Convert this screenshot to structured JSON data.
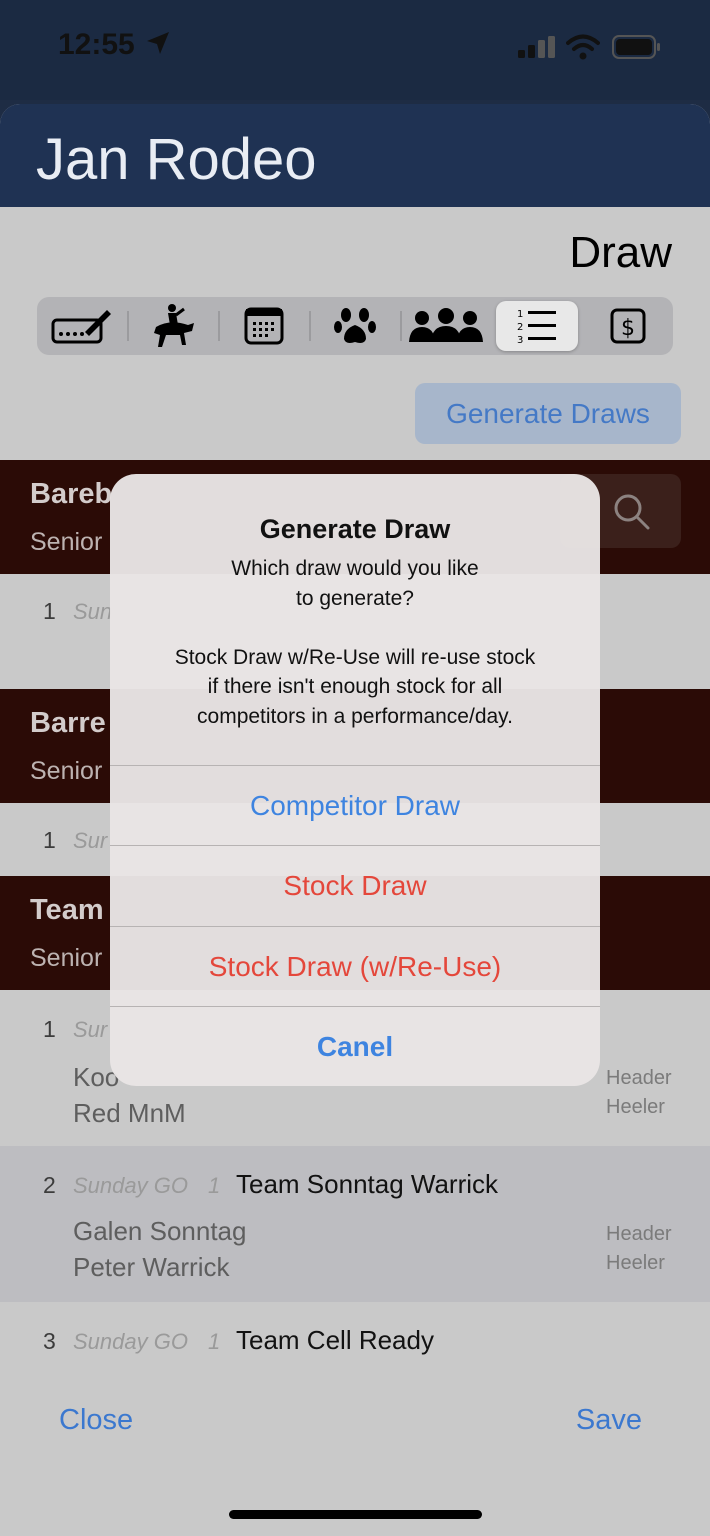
{
  "status_bar": {
    "time": "12:55"
  },
  "header": {
    "title": "Jan Rodeo"
  },
  "page": {
    "title": "Draw"
  },
  "segments": [
    {
      "name": "entry",
      "icon": "pen-entry-icon"
    },
    {
      "name": "bronc",
      "icon": "bronc-rider-icon"
    },
    {
      "name": "calendar",
      "icon": "calendar-icon"
    },
    {
      "name": "animals",
      "icon": "paw-icon"
    },
    {
      "name": "people",
      "icon": "people-icon"
    },
    {
      "name": "draw-list",
      "icon": "numbered-list-icon"
    },
    {
      "name": "payments",
      "icon": "dollar-icon"
    }
  ],
  "generate_button": "Generate Draws",
  "sections": [
    {
      "title": "Bareb",
      "subtitle": "Senior"
    },
    {
      "title": "Barre",
      "subtitle": "Senior"
    },
    {
      "title": "Team",
      "subtitle": "Senior"
    }
  ],
  "rows": [
    {
      "num": "1",
      "day": "Sun"
    },
    {
      "num": "1",
      "day": "Sur"
    },
    {
      "num": "1",
      "day": "Sur",
      "members": [
        "Koo",
        "Red MnM"
      ],
      "roles": [
        "Header",
        "Heeler"
      ]
    },
    {
      "num": "2",
      "day": "Sunday GO",
      "go": "1",
      "team": "Team Sonntag Warrick",
      "members": [
        "Galen Sonntag",
        "Peter Warrick"
      ],
      "roles": [
        "Header",
        "Heeler"
      ]
    },
    {
      "num": "3",
      "day": "Sunday GO",
      "go": "1",
      "team": "Team Cell Ready"
    }
  ],
  "footer": {
    "close": "Close",
    "save": "Save"
  },
  "alert": {
    "title": "Generate Draw",
    "message_lines": [
      "Which draw would you like",
      "to generate?",
      "",
      "Stock Draw w/Re-Use will re-use stock",
      "if there isn't enough stock for all",
      "competitors in a performance/day."
    ],
    "buttons": {
      "competitor": "Competitor Draw",
      "stock": "Stock Draw",
      "stock_reuse": "Stock Draw (w/Re-Use)",
      "cancel": "Canel"
    }
  },
  "colors": {
    "header_bg": "#1f3253",
    "section_bg": "#2b0b06",
    "link_blue": "#3b78cf",
    "destructive_red": "#e4473b"
  }
}
